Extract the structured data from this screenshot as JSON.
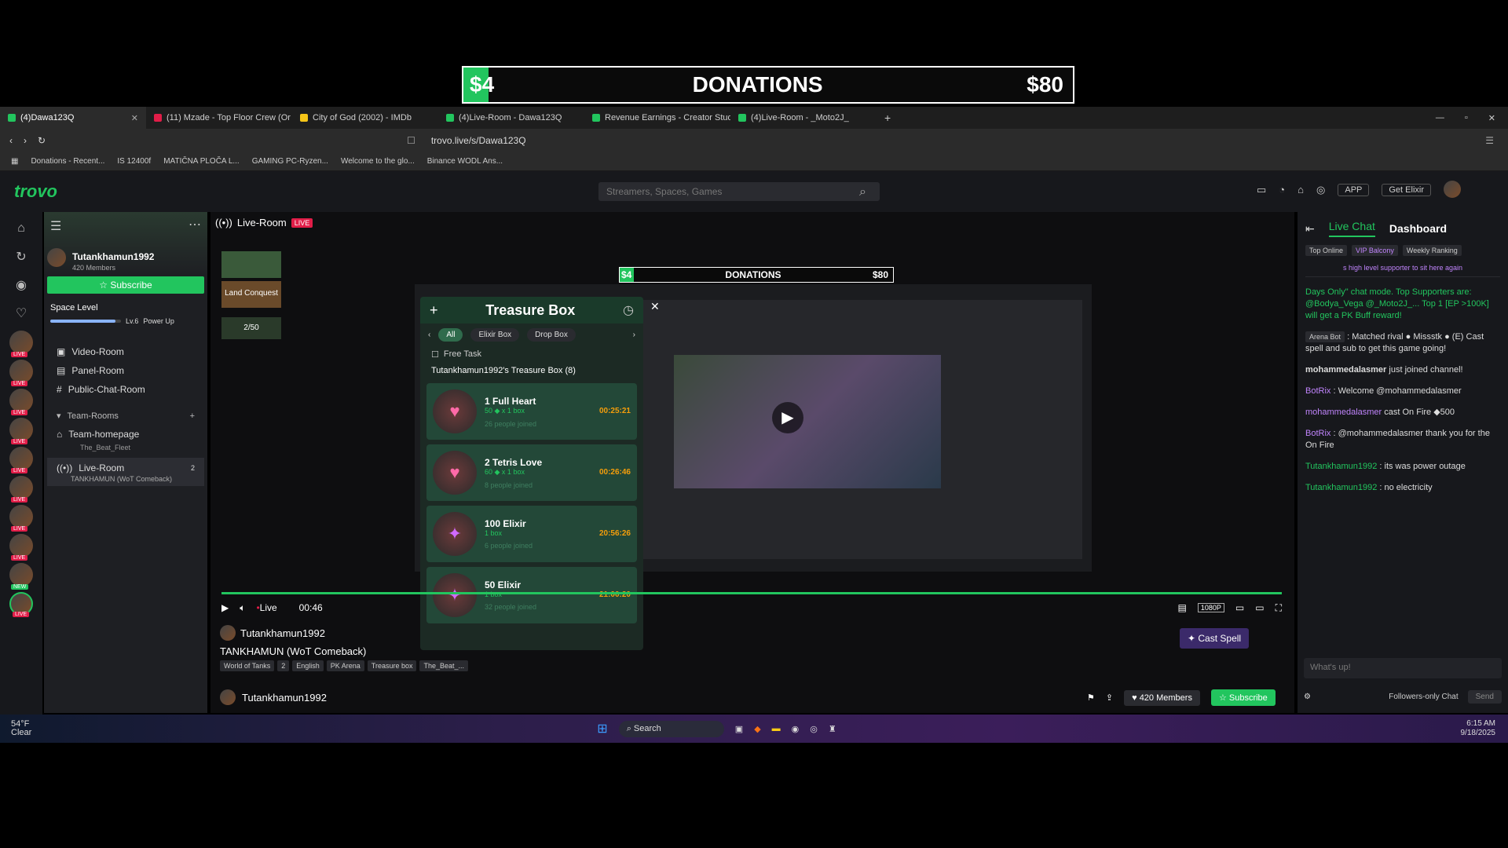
{
  "donation": {
    "current": "$4",
    "title": "DONATIONS",
    "goal": "$80"
  },
  "tabs": [
    {
      "label": "(4)Dawa123Q",
      "active": true
    },
    {
      "label": "(11) Mzade - Top Floor Crew (Or"
    },
    {
      "label": "City of God (2002) - IMDb"
    },
    {
      "label": "(4)Live-Room - Dawa123Q"
    },
    {
      "label": "Revenue Earnings - Creator Studio"
    },
    {
      "label": "(4)Live-Room - _Moto2J_"
    }
  ],
  "address": {
    "url": "trovo.live/s/Dawa123Q"
  },
  "bookmarks": [
    "Donations - Recent...",
    "IS 12400f",
    "MATIČNA PLOČA L...",
    "GAMING PC-Ryzen...",
    "Welcome to the glo...",
    "Binance WODL Ans..."
  ],
  "header": {
    "logo": "trovo",
    "search_placeholder": "Streamers, Spaces, Games",
    "app_label": "APP",
    "elixir_label": "Get Elixir"
  },
  "space": {
    "name": "Tutankhamun1992",
    "members": "420 Members",
    "subscribe": "Subscribe",
    "level_label": "Space Level",
    "level": "Lv.6",
    "power_up": "Power Up",
    "menu": [
      "Video-Room",
      "Panel-Room",
      "Public-Chat-Room"
    ],
    "team_rooms_label": "Team-Rooms",
    "team_homepage": "Team-homepage",
    "team_homepage_sub": "The_Beat_Fleet",
    "live_room": "Live-Room",
    "live_room_count": "2",
    "live_room_sub": "TANKHAMUN (WoT Comeback)"
  },
  "main": {
    "room_title": "Live-Room",
    "live_badge": "LIVE",
    "side_progress": "2/50",
    "land_conquest": "Land Conquest"
  },
  "inner_donation": {
    "current": "$4",
    "title": "DONATIONS",
    "goal": "$80"
  },
  "treasure": {
    "title": "Treasure Box",
    "filters": [
      "All",
      "Elixir Box",
      "Drop Box"
    ],
    "free_task": "Free Task",
    "owner": "Tutankhamun1992's Treasure Box (8)",
    "items": [
      {
        "name": "1 Full Heart",
        "sub": "50 ◆ x 1 box",
        "join": "26 people joined",
        "time": "00:25:21",
        "icon": "♥"
      },
      {
        "name": "2 Tetris Love",
        "sub": "60 ◆ x 1 box",
        "join": "8 people joined",
        "time": "00:26:46",
        "icon": "♥"
      },
      {
        "name": "100 Elixir",
        "sub": "1 box",
        "join": "6 people joined",
        "time": "20:56:26",
        "icon": "✦"
      },
      {
        "name": "50 Elixir",
        "sub": "1 box",
        "join": "32 people joined",
        "time": "21:00:20",
        "icon": "✦"
      }
    ]
  },
  "player": {
    "live": "Live",
    "time": "00:46",
    "quality": "1080P"
  },
  "stream": {
    "streamer": "Tutankhamun1992",
    "title": "TANKHAMUN (WoT Comeback)",
    "tags": [
      "World of Tanks",
      "2",
      "English",
      "PK Arena",
      "Treasure box",
      "The_Beat_..."
    ],
    "cast_spell": "Cast Spell",
    "bottom_name": "Tutankhamun1992",
    "members": "420 Members",
    "subscribe": "Subscribe"
  },
  "chat": {
    "tabs": [
      "Live Chat",
      "Dashboard"
    ],
    "subtabs": [
      "Top Online",
      "VIP Balcony",
      "Weekly Ranking"
    ],
    "promo": "s high level supporter to sit here again",
    "messages": [
      {
        "user": "",
        "text": "Days Only\" chat mode. Top Supporters are: @Bodya_Vega @_Moto2J_... Top 1 [EP >100K] will get a PK Buff reward!"
      },
      {
        "user": "Arena Bot",
        "text": ": Matched rival ● Missstk ● (E) Cast spell and sub to get this game going!"
      },
      {
        "user": "mohammedalasmer",
        "text": "just joined channel!"
      },
      {
        "user": "BotRix",
        "text": ": Welcome @mohammedalasmer"
      },
      {
        "user": "mohammedalasmer",
        "text": "cast On Fire ◆500"
      },
      {
        "user": "BotRix",
        "text": ": @mohammedalasmer thank you for the On Fire"
      },
      {
        "user": "Tutankhamun1992",
        "text": ": its was power outage"
      },
      {
        "user": "Tutankhamun1992",
        "text": ": no electricity"
      }
    ],
    "input_placeholder": "What's up!",
    "followers_only": "Followers-only Chat",
    "send": "Send"
  },
  "taskbar": {
    "temp": "54°F",
    "weather": "Clear",
    "search": "Search",
    "time": "6:15 AM",
    "date": "9/18/2025"
  }
}
